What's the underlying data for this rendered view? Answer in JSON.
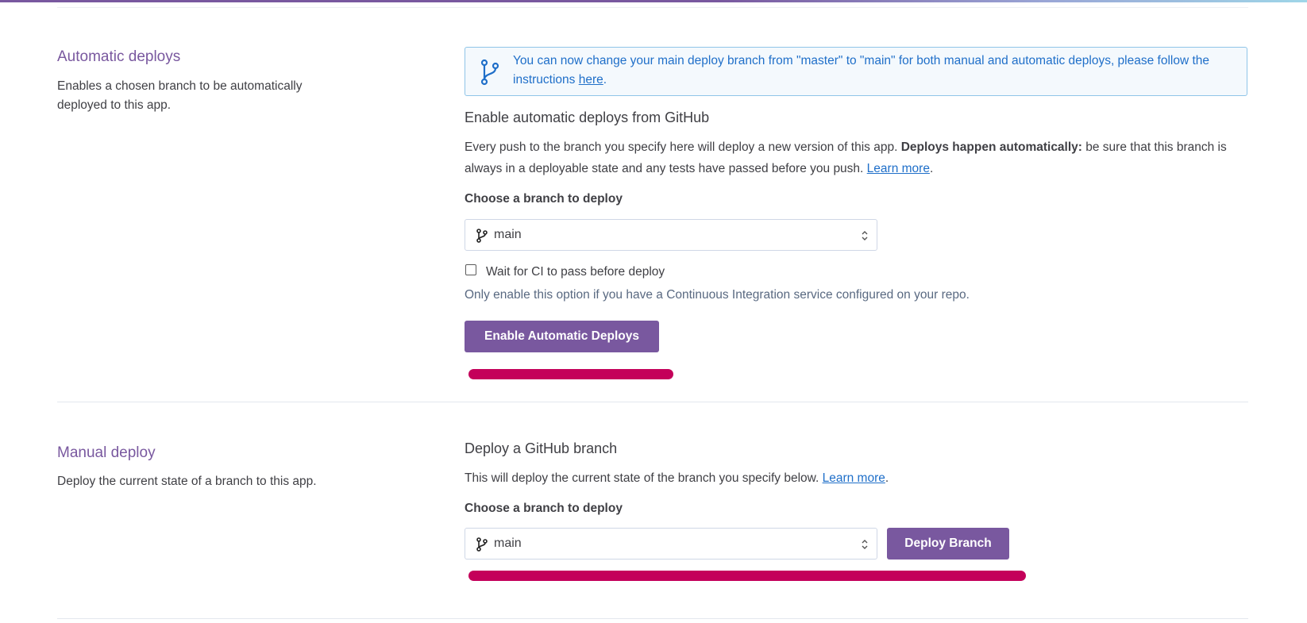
{
  "automatic": {
    "title": "Automatic deploys",
    "description": "Enables a chosen branch to be automatically deployed to this app.",
    "notice": {
      "text_before": "You can now change your main deploy branch from \"master\" to \"main\" for both manual and automatic deploys, please follow the instructions ",
      "link": "here",
      "text_after": "."
    },
    "heading": "Enable automatic deploys from GitHub",
    "body_before": "Every push to the branch you specify here will deploy a new version of this app. ",
    "body_bold": "Deploys happen automatically:",
    "body_after": " be sure that this branch is always in a deployable state and any tests have passed before you push. ",
    "learn_more": "Learn more",
    "period": ".",
    "branch_label": "Choose a branch to deploy",
    "branch_value": "main",
    "ci_label": "Wait for CI to pass before deploy",
    "ci_hint": "Only enable this option if you have a Continuous Integration service configured on your repo.",
    "button": "Enable Automatic Deploys"
  },
  "manual": {
    "title": "Manual deploy",
    "description": "Deploy the current state of a branch to this app.",
    "heading": "Deploy a GitHub branch",
    "body": "This will deploy the current state of the branch you specify below. ",
    "learn_more": "Learn more",
    "period": ".",
    "branch_label": "Choose a branch to deploy",
    "branch_value": "main",
    "button": "Deploy Branch"
  },
  "colors": {
    "accent": "#79589f",
    "link": "#1f6fc9",
    "annotation": "#c4005a"
  }
}
